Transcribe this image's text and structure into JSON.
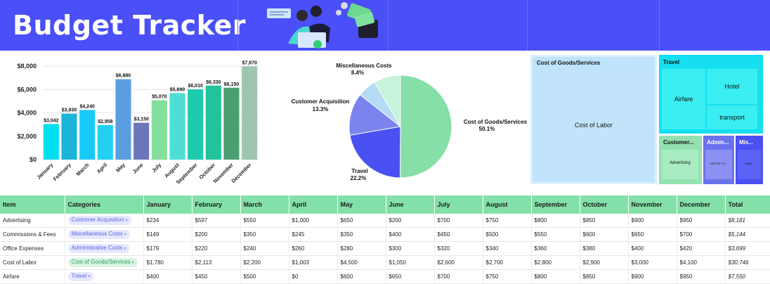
{
  "header": {
    "title": "Budget Tracker",
    "bg": "#4a4ff7"
  },
  "bar_chart": {
    "type": "bar",
    "categories": [
      "January",
      "February",
      "March",
      "April",
      "May",
      "June",
      "July",
      "August",
      "September",
      "October",
      "November",
      "December"
    ],
    "values": [
      3042,
      3930,
      4240,
      2958,
      6880,
      3150,
      5070,
      5690,
      6010,
      6330,
      6150,
      7970
    ],
    "value_labels": [
      "$3,042",
      "$3,930",
      "$4,240",
      "$2,958",
      "$6,880",
      "$3,150",
      "$5,070",
      "$5,690",
      "$6,010",
      "$6,330",
      "$6,150",
      "$7,970"
    ],
    "colors": [
      "#00dff0",
      "#1ab5d9",
      "#18c9f5",
      "#21d0f3",
      "#5a9ee0",
      "#6a76b8",
      "#84df9c",
      "#4fded6",
      "#1ecbae",
      "#22c29a",
      "#4a9f72",
      "#9cc7ae"
    ],
    "yticks": [
      "$8,000",
      "$6,000",
      "$4,000",
      "$2,000",
      "$0"
    ],
    "ytick_values": [
      8000,
      6000,
      4000,
      2000,
      0
    ],
    "ylim": [
      0,
      8000
    ],
    "grid": true
  },
  "pie_chart": {
    "type": "pie",
    "slices": [
      {
        "label": "Cost of Goods/Services",
        "pct_label": "50.1%",
        "value": 50.1,
        "color": "#86dfa6"
      },
      {
        "label": "Travel",
        "pct_label": "22.2%",
        "value": 22.2,
        "color": "#4a50f2"
      },
      {
        "label": "Customer Acquisition",
        "pct_label": "13.3%",
        "value": 13.3,
        "color": "#7b83ef"
      },
      {
        "label": "",
        "pct_label": "",
        "value": 6.0,
        "color": "#b6dcf5"
      },
      {
        "label": "Miscellaneous Costs",
        "pct_label": "8.4%",
        "value": 8.4,
        "color": "#c7f2dc"
      }
    ]
  },
  "treemap": {
    "cogs_title": "Cost of Goods/Services",
    "cost_of_labor": "Cost of Labor",
    "travel_title": "Travel",
    "airfare": "Airfare",
    "hotel": "Hotel",
    "transport": "transport",
    "customer_title": "Customer...",
    "advertising": "Advertising",
    "admin_title": "Admin...",
    "admin_sub": "OFFICE EX...",
    "misc_title": "Mis...",
    "misc_sub": "COM..."
  },
  "table": {
    "headers": [
      "Item",
      "Categories",
      "January",
      "February",
      "March",
      "April",
      "May",
      "June",
      "July",
      "August",
      "September",
      "October",
      "November",
      "December",
      "Total"
    ],
    "rows": [
      {
        "item": "Advertising",
        "category": "Customer Acquisition",
        "chip_bg": "#e6e8fd",
        "chip_fg": "#5a62e0",
        "months": [
          "$234",
          "$597",
          "$550",
          "$1,000",
          "$650",
          "$200",
          "$700",
          "$750",
          "$800",
          "$850",
          "$900",
          "$950"
        ],
        "total": "$8,181"
      },
      {
        "item": "Commissions & Fees",
        "category": "Miscellaneous Costs",
        "chip_bg": "#e6e8fd",
        "chip_fg": "#5a62e0",
        "months": [
          "$149",
          "$200",
          "$350",
          "$245",
          "$350",
          "$400",
          "$450",
          "$500",
          "$550",
          "$600",
          "$650",
          "$700"
        ],
        "total": "$5,144"
      },
      {
        "item": "Office Expenses",
        "category": "Administrative Costs",
        "chip_bg": "#e6e8fd",
        "chip_fg": "#5a62e0",
        "months": [
          "$179",
          "$220",
          "$240",
          "$260",
          "$280",
          "$300",
          "$320",
          "$340",
          "$360",
          "$380",
          "$400",
          "$420"
        ],
        "total": "$3,699"
      },
      {
        "item": "Cost of Labor",
        "category": "Cost of Goods/Services",
        "chip_bg": "#d8f5e2",
        "chip_fg": "#2e9a5c",
        "months": [
          "$1,780",
          "$2,113",
          "$2,200",
          "$1,003",
          "$4,500",
          "$1,050",
          "$2,600",
          "$2,700",
          "$2,800",
          "$2,900",
          "$3,000",
          "$4,100"
        ],
        "total": "$30,746"
      },
      {
        "item": "Airfare",
        "category": "Travel",
        "chip_bg": "#e6e8fd",
        "chip_fg": "#5a62e0",
        "months": [
          "$400",
          "$450",
          "$500",
          "$0",
          "$600",
          "$650",
          "$700",
          "$750",
          "$800",
          "$850",
          "$900",
          "$950"
        ],
        "total": "$7,550"
      }
    ]
  }
}
